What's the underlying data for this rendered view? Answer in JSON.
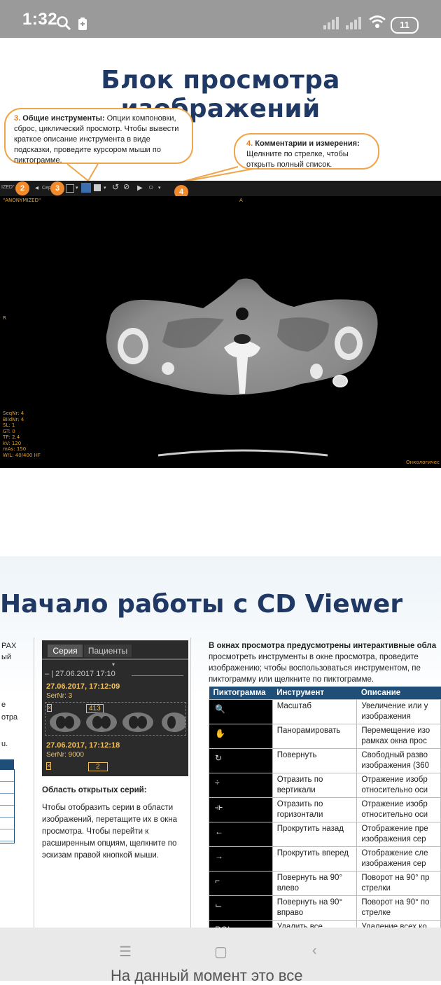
{
  "status_bar": {
    "time": "1:32",
    "battery": "11"
  },
  "slide1": {
    "title": "Блок просмотра изображений",
    "callout3": {
      "number": "3.",
      "heading": "Общие инструменты:",
      "text": " Опции компоновки, сброс, циклический просмотр. Чтобы вывести краткое описание инструмента в виде подсказки, проведите курсором мыши по пиктограмме."
    },
    "callout4": {
      "number": "4.",
      "heading": "Комментарии и измерения:",
      "text": "Щелкните по стрелке, чтобы открыть полный список."
    },
    "toolbar": {
      "left_text": "IZED\"",
      "seq_text": "Cep",
      "badges": [
        "2",
        "3",
        "4"
      ]
    },
    "viewer": {
      "top_left": "\"ANONYMIZED\"",
      "top_center": "A",
      "left_marker": "R",
      "info_lines": [
        "SeqNr: 4",
        "BildNr: 4",
        "SL: 1",
        "GT: 0",
        "TP: 2.4",
        "kV: 120",
        "mAs: 150",
        "W/L: 40/400 HF"
      ],
      "bottom_right": "Онкологичес"
    }
  },
  "slide2": {
    "title": "Начало работы с CD Viewer",
    "left_fragments": [
      "РАХ",
      "ый",
      "е",
      "отра",
      "u."
    ],
    "series_panel": {
      "tab_series": "Серия",
      "tab_patients": "Пациенты",
      "group_header": "| 27.06.2017 17:10",
      "series": [
        {
          "date": "27.06.2017, 17:12:09",
          "sernr": "SerNr: 3",
          "count": "413"
        },
        {
          "date": "27.06.2017, 17:12:18",
          "sernr": "SerNr: 9000",
          "count": "2"
        }
      ]
    },
    "mid_heading": "Область открытых серий:",
    "mid_text": "Чтобы отобразить серии в области изображений, перетащите их в окна просмотра. Чтобы перейти к расширенным опциям, щелкните по эскизам правой кнопкой мыши.",
    "right_intro": {
      "line1": "В окнах просмотра предусмотрены интерактивные обла",
      "line2": "просмотреть инструменты в окне просмотра, проведите",
      "line3": "изображению; чтобы воспользоваться инструментом, пе",
      "line4": "пиктограмму или щелкните по пиктограмме."
    },
    "table": {
      "headers": [
        "Пиктограмма",
        "Инструмент",
        "Описание"
      ],
      "rows": [
        {
          "icon": "magnifier-icon",
          "glyph": "🔍",
          "tool": "Масштаб",
          "desc": "Увеличение или у изображения"
        },
        {
          "icon": "hand-icon",
          "glyph": "✋",
          "tool": "Панорамировать",
          "desc": "Перемещение изо рамках окна прос"
        },
        {
          "icon": "rotate-icon",
          "glyph": "↻",
          "tool": "Повернуть",
          "desc": "Свободный разво изображения (360"
        },
        {
          "icon": "flip-vertical-icon",
          "glyph": "÷",
          "tool": "Отразить по вертикали",
          "desc": "Отражение изобр относительно оси"
        },
        {
          "icon": "flip-horizontal-icon",
          "glyph": "⟛",
          "tool": "Отразить по горизонтали",
          "desc": "Отражение изобр относительно оси"
        },
        {
          "icon": "arrow-left-icon",
          "glyph": "←",
          "tool": "Прокрутить назад",
          "desc": "Отображение пре изображения сер"
        },
        {
          "icon": "arrow-right-icon",
          "glyph": "→",
          "tool": "Прокрутить вперед",
          "desc": "Отображение сле изображения сер"
        },
        {
          "icon": "rotate-left-icon",
          "glyph": "⌐",
          "tool": "Повернуть на 90° влево",
          "desc": "Поворот на 90° пр стрелки"
        },
        {
          "icon": "rotate-right-icon",
          "glyph": "⌙",
          "tool": "Повернуть на 90° вправо",
          "desc": "Поворот на 90° по стрелке"
        },
        {
          "icon": "roi-icon",
          "glyph": "ROI",
          "tool": "Удалить все",
          "desc": "Удаление всех ко"
        }
      ]
    }
  },
  "nav": {
    "peek_text": "На данный момент это все"
  }
}
